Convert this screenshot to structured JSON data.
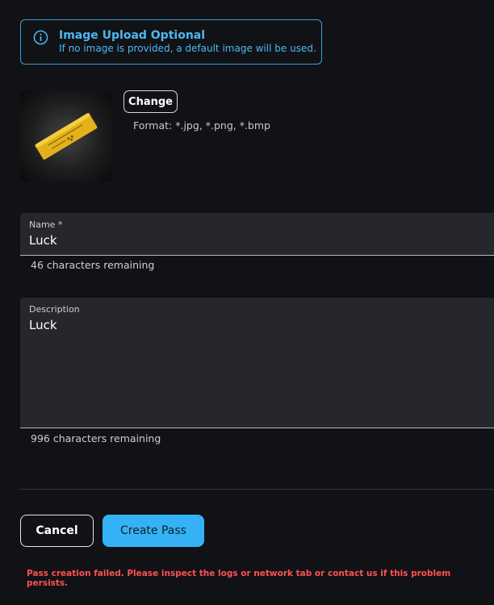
{
  "info": {
    "title": "Image Upload Optional",
    "text": "If no image is provided, a default image will be used."
  },
  "image": {
    "change_label": "Change",
    "format_text": "Format: *.jpg, *.png, *.bmp"
  },
  "name_field": {
    "label": "Name *",
    "value": "Luck",
    "helper": "46 characters remaining"
  },
  "description_field": {
    "label": "Description",
    "value": "Luck",
    "helper": "996 characters remaining"
  },
  "actions": {
    "cancel_label": "Cancel",
    "create_label": "Create Pass"
  },
  "error": {
    "text": "Pass creation failed. Please inspect the logs or network tab or contact us if this problem persists."
  },
  "colors": {
    "accent": "#35b2f6",
    "info": "#4db8f0",
    "error": "#ff5151",
    "background": "#111216"
  }
}
